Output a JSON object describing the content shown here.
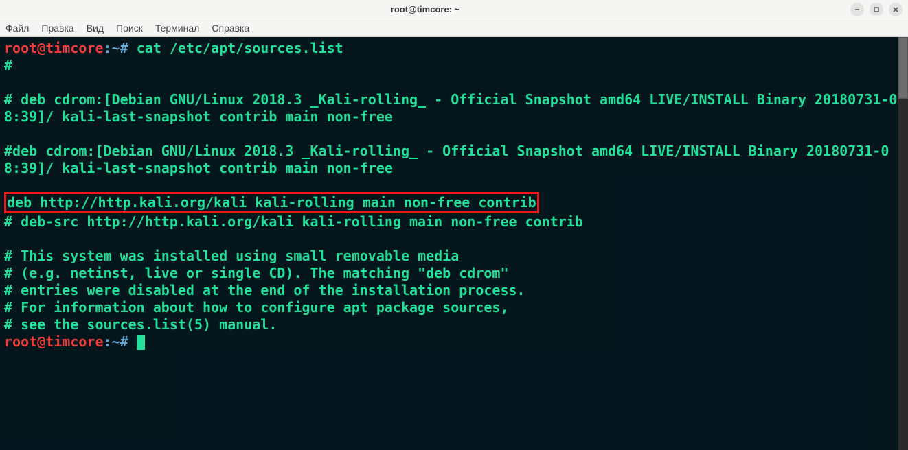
{
  "window": {
    "title": "root@timcore: ~"
  },
  "menubar": [
    "Файл",
    "Правка",
    "Вид",
    "Поиск",
    "Терминал",
    "Справка"
  ],
  "prompt": {
    "user": "root@timcore",
    "sep1": ":",
    "path": "~",
    "sep2": "#"
  },
  "command": "cat /etc/apt/sources.list",
  "output": {
    "l1": "#",
    "l2": "",
    "l3": "# deb cdrom:[Debian GNU/Linux 2018.3 _Kali-rolling_ - Official Snapshot amd64 LIVE/INSTALL Binary 20180731-08:39]/ kali-last-snapshot contrib main non-free",
    "l4": "",
    "l5": "#deb cdrom:[Debian GNU/Linux 2018.3 _Kali-rolling_ - Official Snapshot amd64 LIVE/INSTALL Binary 20180731-08:39]/ kali-last-snapshot contrib main non-free",
    "l6": "",
    "highlight": "deb http://http.kali.org/kali kali-rolling main non-free contrib",
    "l7": "# deb-src http://http.kali.org/kali kali-rolling main non-free contrib",
    "l8": "",
    "l9": "# This system was installed using small removable media",
    "l10": "# (e.g. netinst, live or single CD). The matching \"deb cdrom\"",
    "l11": "# entries were disabled at the end of the installation process.",
    "l12": "# For information about how to configure apt package sources,",
    "l13": "# see the sources.list(5) manual."
  }
}
